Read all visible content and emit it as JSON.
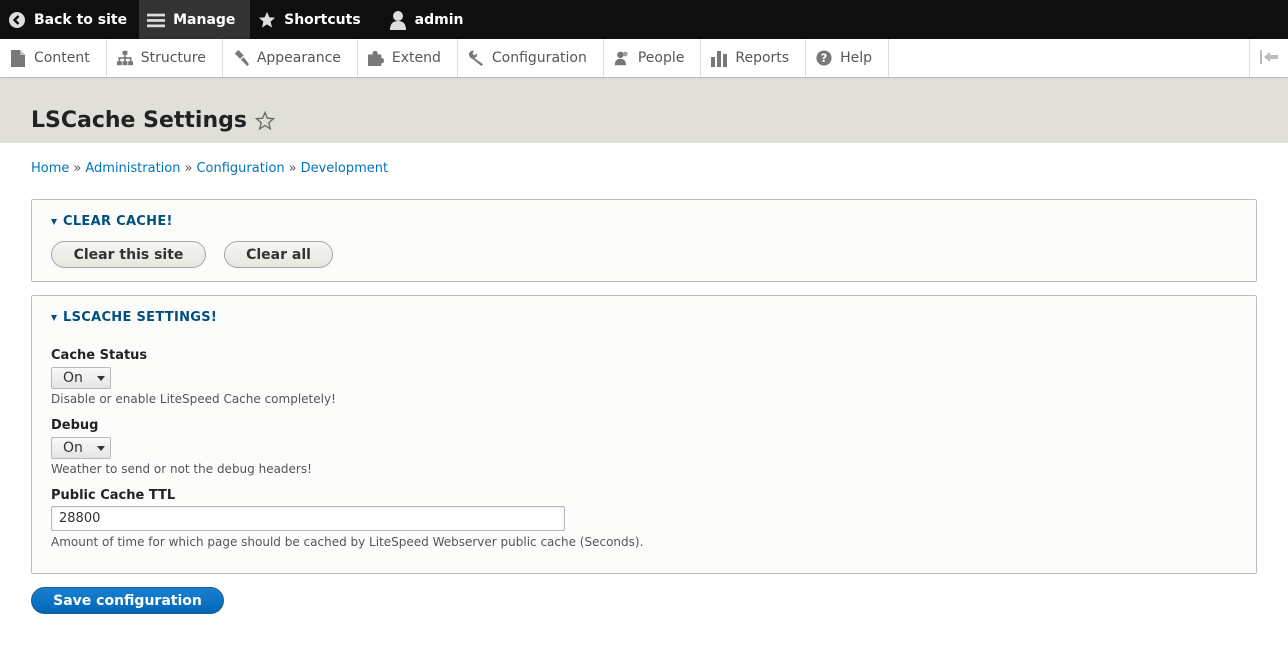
{
  "toolbar": {
    "back_label": "Back to site",
    "manage_label": "Manage",
    "shortcuts_label": "Shortcuts",
    "user_label": "admin"
  },
  "tray": {
    "items": [
      {
        "label": "Content",
        "icon": "file-icon"
      },
      {
        "label": "Structure",
        "icon": "sitemap-icon"
      },
      {
        "label": "Appearance",
        "icon": "paintbrush-icon"
      },
      {
        "label": "Extend",
        "icon": "puzzle-icon"
      },
      {
        "label": "Configuration",
        "icon": "wrench-icon"
      },
      {
        "label": "People",
        "icon": "people-icon"
      },
      {
        "label": "Reports",
        "icon": "bar-chart-icon"
      },
      {
        "label": "Help",
        "icon": "help-icon"
      }
    ]
  },
  "page": {
    "title": "LSCache Settings"
  },
  "breadcrumb": [
    "Home",
    "Administration",
    "Configuration",
    "Development"
  ],
  "clear_cache": {
    "legend": "CLEAR CACHE!",
    "clear_site_label": "Clear this site",
    "clear_all_label": "Clear all"
  },
  "settings": {
    "legend": "LSCACHE SETTINGS!",
    "cache_status": {
      "label": "Cache Status",
      "value": "On",
      "description": "Disable or enable LiteSpeed Cache completely!"
    },
    "debug": {
      "label": "Debug",
      "value": "On",
      "description": "Weather to send or not the debug headers!"
    },
    "public_ttl": {
      "label": "Public Cache TTL",
      "value": "28800",
      "description": "Amount of time for which page should be cached by LiteSpeed Webserver public cache (Seconds)."
    }
  },
  "save_label": "Save configuration",
  "colors": {
    "link": "#0074bd",
    "legend": "#004f80",
    "primary_button": "#0067b8",
    "toolbar_bg": "#0f0f0f",
    "header_band": "#e0e0d8"
  }
}
